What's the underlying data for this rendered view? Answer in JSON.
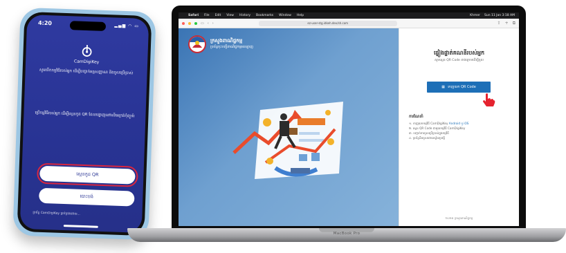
{
  "phone": {
    "time": "4:20",
    "status": "▂▄▆ ◠ ▭",
    "app_name": "CamDigiKey",
    "text1": "សូមបើកកម្មវិធីរបស់អ្នក ដើម្បីបញ្ជាក់អត្តសញ្ញាណ និងចូលប្រើប្រាស់",
    "text2": "ប្រើកម្មវិធីរបស់អ្នក ដើម្បីស្កេនកូដ QR ដែលបង្ហាញនៅលើអេក្រង់កុំព្យូទ័រ",
    "scan_button": "ស្កេនកូដ QR",
    "cancel_button": "បោះបង់",
    "footer": "ប្រព័ន្ធ CamDigiKey គ្រប់គ្រងដោយ..."
  },
  "mac": {
    "menubar": {
      "apple": "",
      "items": [
        "Safari",
        "File",
        "Edit",
        "View",
        "History",
        "Bookmarks",
        "Window",
        "Help"
      ],
      "right": [
        "Khmer",
        "Sun 11 Jan  3:18 AM"
      ]
    },
    "browser": {
      "url": "ez-user-stg.idkeh.dev/sh.com"
    },
    "page": {
      "brand_title": "ក្រសួងពាណិជ្ជកម្ម",
      "brand_sub": "ប្រព័ន្ធចុះបញ្ជីពាណិជ្ជកម្មអនឡាញ",
      "title": "ផ្ទៀងផ្ទាត់គណនីរបស់អ្នក",
      "subtitle": "សូមស្កេន QR Code ខាងក្រោមដើម្បីចូល",
      "qr_button": "ទាញយក QR Code",
      "how_title": "ការណែនាំ",
      "steps": [
        {
          "prefix": "១. ទាញយកកម្មវិធី CamDigiKey ",
          "link": "Android ឬ iOS"
        },
        {
          "prefix": "២. ស្កេន QR Code ជាមួយកម្មវិធី CamDigiKey",
          "link": ""
        },
        {
          "prefix": "៣. បញ្ជាក់ការចូលប្រើប្រាស់ក្នុងកម្មវិធី",
          "link": ""
        },
        {
          "prefix": "៤. ប្រព័ន្ធនឹងចូលដោយស្វ័យប្រវត្តិ",
          "link": ""
        }
      ],
      "footer": "២០២៥ ក្រសួងពាណិជ្ជកម្ម"
    },
    "base_label": "MacBook Pro"
  },
  "colors": {
    "phone_bg": "#283393",
    "primary_button": "#1d6fb7",
    "highlight_red": "#d9263f"
  }
}
